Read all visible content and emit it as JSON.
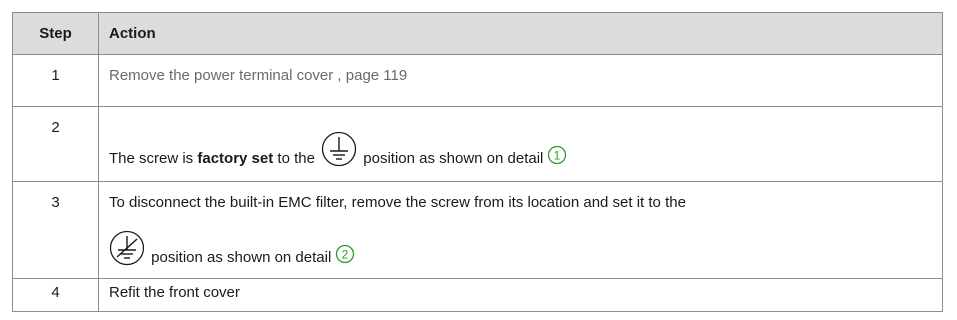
{
  "table": {
    "headers": {
      "step": "Step",
      "action": "Action"
    },
    "rows": [
      {
        "step": "1",
        "action_link": "Remove the power terminal cover , page 119"
      },
      {
        "step": "2",
        "text_before": "The screw is ",
        "text_bold": "factory set",
        "text_to": " to the ",
        "text_after": " position as shown on detail",
        "detail_number": "1",
        "symbol": "protective-earth-icon"
      },
      {
        "step": "3",
        "line1": "To disconnect the built-in EMC filter, remove the screw from its location and set it to the",
        "text_after": " position as shown on detail",
        "detail_number": "2",
        "symbol": "disconnected-earth-icon"
      },
      {
        "step": "4",
        "action": "Refit the front cover"
      }
    ]
  },
  "colors": {
    "header_bg": "#dcdcdc",
    "link": "#6a6a6a",
    "detail_circle": "#2e9c2e",
    "border": "#8c8c8c"
  }
}
